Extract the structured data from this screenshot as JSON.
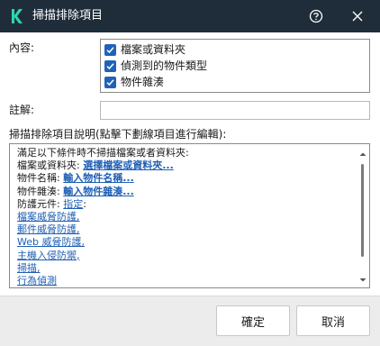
{
  "window": {
    "title": "掃描排除項目",
    "brand_color": "#1f2d3a",
    "accent_color": "#1f63b8",
    "link_color": "#1f5fb5"
  },
  "icons": {
    "app": "kaspersky-k-icon",
    "help": "question-circle-icon",
    "close": "close-icon"
  },
  "content": {
    "label": "內容:",
    "options": [
      {
        "label": "檔案或資料夾",
        "checked": true
      },
      {
        "label": "偵測到的物件類型",
        "checked": true
      },
      {
        "label": "物件雜湊",
        "checked": true
      }
    ]
  },
  "comment": {
    "label": "註解:",
    "value": "",
    "placeholder": ""
  },
  "description": {
    "label": "掃描排除項目說明(點擊下劃線項目進行編輯):",
    "header": "滿足以下條件時不掃描檔案或者資料夾:",
    "file_label": "檔案或資料夾:",
    "file_link": "選擇檔案或資料夾...",
    "object_name_label": "物件名稱:",
    "object_name_link": "輸入物件名稱...",
    "object_hash_label": "物件雜湊:",
    "object_hash_link": "輸入物件雜湊...",
    "protection_label": "防護元件:",
    "protection_link": "指定",
    "protection_suffix": ":",
    "components": [
      "檔案威脅防護,",
      "郵件威脅防護,",
      "Web 威脅防護,",
      "主機入侵防禦,",
      "掃描,",
      "行為偵測"
    ]
  },
  "buttons": {
    "ok": "確定",
    "cancel": "取消"
  }
}
